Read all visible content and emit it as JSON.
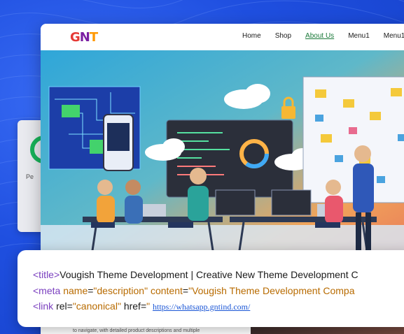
{
  "site": {
    "logo_text": [
      "G",
      "N",
      "T"
    ],
    "nav": [
      "Home",
      "Shop",
      "About Us",
      "Menu1",
      "Menu1"
    ],
    "active_nav": "About Us",
    "below_text": "to navigate, with detailed product descriptions and multiple"
  },
  "back_card": {
    "text": "Pe"
  },
  "code": {
    "line1": {
      "open_tag": "<title>",
      "text": "Vougish Theme Development | Creative New Theme Development C"
    },
    "line2": {
      "tag": "<meta",
      "attr1": "name",
      "val1": "\"description\"",
      "attr2": "content",
      "val2": "\"Vougish Theme Development Compa"
    },
    "line3": {
      "tag": "<link",
      "attr1": "rel",
      "val1": "\"canonical\"",
      "attr2": "href",
      "val2_prefix": "\"",
      "url": "https://whatsapp.gntind.com/"
    }
  },
  "colors": {
    "background_blue": "#1f4fe0",
    "tag_purple": "#7a3fbf",
    "attr_orange": "#b86b00",
    "link_blue": "#1a56d6",
    "active_nav_green": "#1b7a3a"
  },
  "icons": {
    "hero_lock": "lock-icon",
    "hero_clouds": "cloud-icon"
  }
}
